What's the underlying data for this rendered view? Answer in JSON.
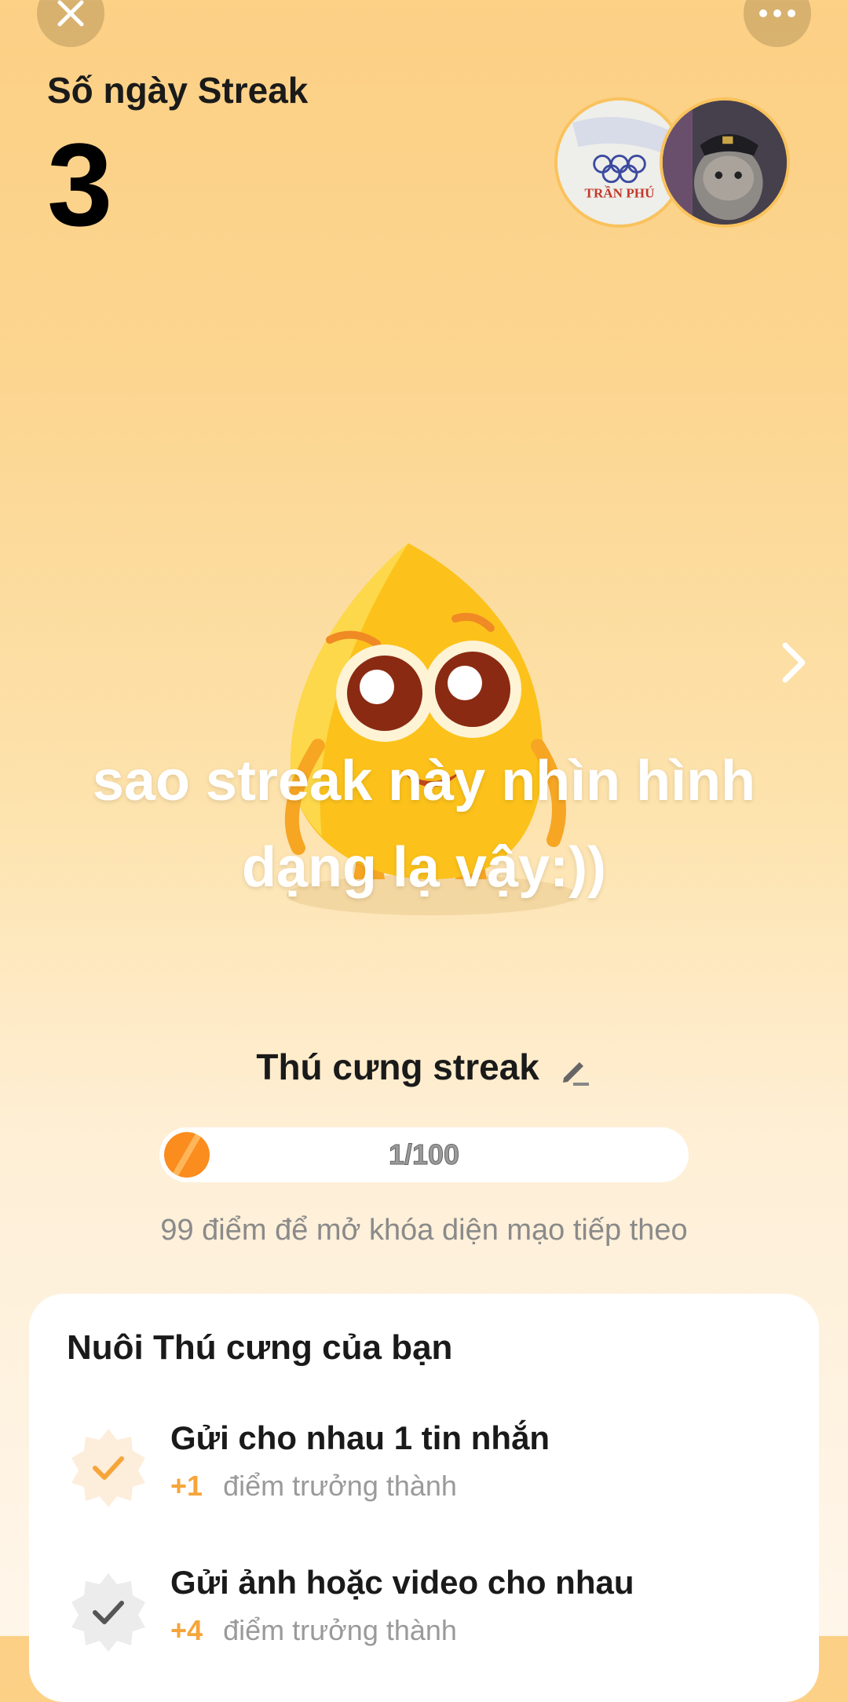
{
  "header": {
    "close_icon": "close-icon",
    "more_icon": "more-icon",
    "streak_label": "Số ngày Streak",
    "streak_count": "3"
  },
  "avatars": [
    {
      "name": "avatar-friend-1",
      "badge_text": "TRẦN PHÚ"
    },
    {
      "name": "avatar-friend-2"
    }
  ],
  "caption": {
    "line1": "sao streak này nhìn hình",
    "line2": "dạng lạ vậy:))"
  },
  "pet": {
    "title": "Thú cưng streak",
    "progress_text": "1/100",
    "progress_value": 0.01,
    "hint": "99 điểm để mở khóa diện mạo tiếp theo"
  },
  "card": {
    "title": "Nuôi Thú cưng của bạn",
    "tasks": [
      {
        "title": "Gửi cho nhau 1 tin nhắn",
        "points": "+1",
        "label": "điểm trưởng thành",
        "done": true
      },
      {
        "title": "Gửi ảnh hoặc video cho nhau",
        "points": "+4",
        "label": "điểm trưởng thành",
        "done": false
      }
    ]
  },
  "colors": {
    "accent": "#fb8c1e",
    "points": "#f6a53a",
    "bg_top": "#fcd085"
  }
}
